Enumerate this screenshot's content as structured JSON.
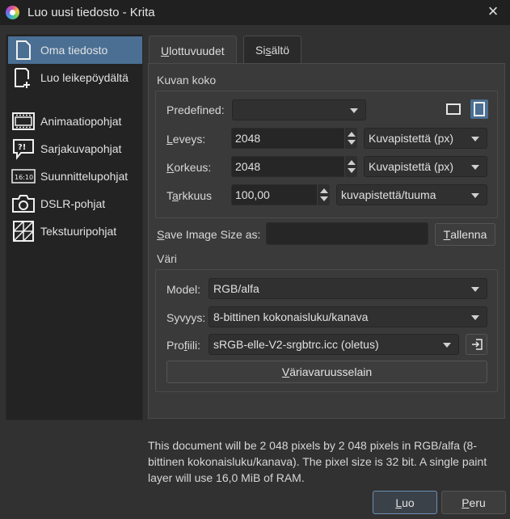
{
  "window": {
    "title": "Luo uusi tiedosto - Krita",
    "close_label": "×"
  },
  "sidebar": {
    "items": [
      {
        "label": "Oma tiedosto",
        "icon": "blank-document-icon",
        "selected": true
      },
      {
        "label": "Luo leikepöydältä",
        "icon": "clipboard-paste-icon",
        "selected": false
      },
      {
        "label": "Animaatiopohjat",
        "icon": "film-strip-icon",
        "selected": false
      },
      {
        "label": "Sarjakuvapohjat",
        "icon": "speech-bubble-icon",
        "selected": false
      },
      {
        "label": "Suunnittelupohjat",
        "icon": "aspect-16-10-icon",
        "icon_text": "16:10",
        "selected": false
      },
      {
        "label": "DSLR-pohjat",
        "icon": "camera-icon",
        "selected": false
      },
      {
        "label": "Tekstuuripohjat",
        "icon": "texture-grid-icon",
        "selected": false
      }
    ]
  },
  "tabs": [
    {
      "label_u": "U",
      "label_rest": "lottuvuudet",
      "active": true
    },
    {
      "label_pre": "Si",
      "label_u": "s",
      "label_rest": "ältö",
      "active": false
    }
  ],
  "image_size": {
    "group_label": "Kuvan koko",
    "predefined_label": "Predefined:",
    "predefined_value": "",
    "width_label_u": "L",
    "width_label_rest": "eveys:",
    "width_value": "2048",
    "width_unit": "Kuvapistettä (px)",
    "height_label_u": "K",
    "height_label_rest": "orkeus:",
    "height_value": "2048",
    "height_unit": "Kuvapistettä (px)",
    "resolution_label_pre": "T",
    "resolution_label_u": "a",
    "resolution_label_rest": "rkkuus",
    "resolution_value": "100,00",
    "resolution_unit": "kuvapistettä/tuuma"
  },
  "save_size": {
    "label_u": "S",
    "label_rest": "ave Image Size as:",
    "name_value": "",
    "save_button_u": "T",
    "save_button_rest": "allenna"
  },
  "color": {
    "group_label": "Väri",
    "model_label": "Model:",
    "model_value": "RGB/alfa",
    "depth_label": "Syvyys:",
    "depth_value": "8-bittinen kokonaisluku/kanava",
    "profile_label_pre": "Pro",
    "profile_label_u": "f",
    "profile_label_rest": "iili:",
    "profile_value": "sRGB-elle-V2-srgbtrc.icc (oletus)",
    "space_browser_pre": "",
    "space_browser_u": "V",
    "space_browser_rest": "äriavaruusselain"
  },
  "description": "This document will be 2 048 pixels by 2 048 pixels in RGB/alfa (8-bittinen kokonaisluku/kanava). The pixel size is 32 bit. A single paint layer will use 16,0 MiB of RAM.",
  "footer": {
    "create_u": "L",
    "create_rest": "uo",
    "cancel_u": "P",
    "cancel_rest": "eru"
  },
  "colors": {
    "selection": "#4a6f93",
    "window_bg": "#313131",
    "titlebar_bg": "#202020"
  }
}
